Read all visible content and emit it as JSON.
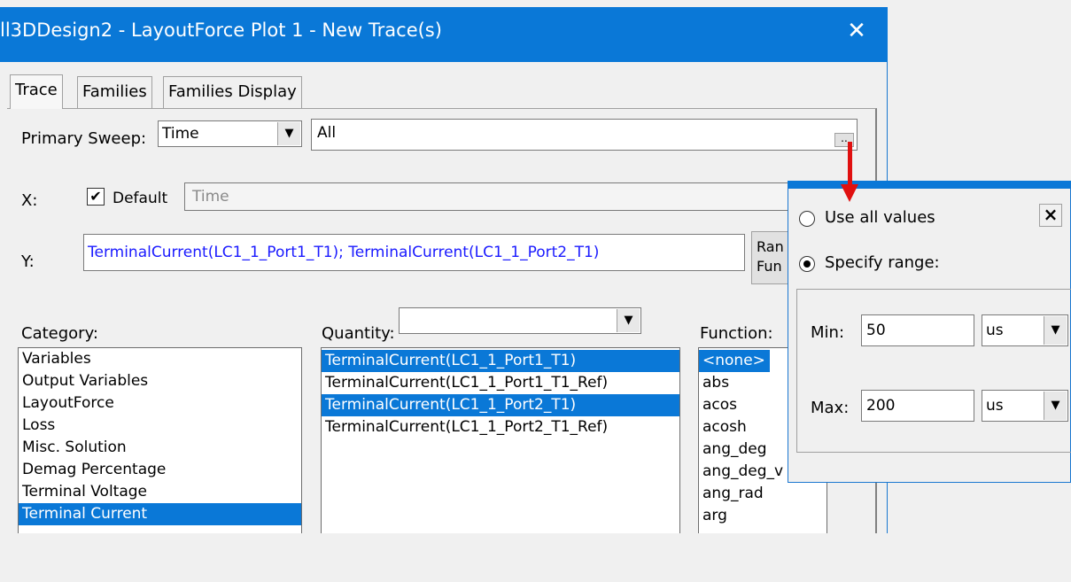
{
  "window": {
    "title": "ll3DDesign2 - LayoutForce Plot 1 - New Trace(s)",
    "close_glyph": "✕"
  },
  "tabs": [
    "Trace",
    "Families",
    "Families Display"
  ],
  "primary_sweep": {
    "label": "Primary Sweep:",
    "value": "Time",
    "range_value": "All",
    "ellipsis_label": ".."
  },
  "x": {
    "label": "X:",
    "default_label": "Default",
    "default_checked": true,
    "value": "Time"
  },
  "y": {
    "label": "Y:",
    "value": "TerminalCurrent(LC1_1_Port1_T1); TerminalCurrent(LC1_1_Port2_T1)",
    "button_line1": "Ran",
    "button_line2": "Fun"
  },
  "category": {
    "label": "Category:",
    "items": [
      "Variables",
      "Output Variables",
      "LayoutForce",
      "Loss",
      "Misc. Solution",
      "Demag Percentage",
      "Terminal Voltage",
      "Terminal Current"
    ],
    "selected": [
      7
    ]
  },
  "quantity": {
    "label": "Quantity:",
    "filter_value": "",
    "items": [
      "TerminalCurrent(LC1_1_Port1_T1)",
      "TerminalCurrent(LC1_1_Port1_T1_Ref)",
      "TerminalCurrent(LC1_1_Port2_T1)",
      "TerminalCurrent(LC1_1_Port2_T1_Ref)"
    ],
    "selected": [
      0,
      2
    ]
  },
  "function": {
    "label": "Function:",
    "items": [
      "<none>",
      "abs",
      "acos",
      "acosh",
      "ang_deg",
      "ang_deg_v",
      "ang_rad",
      "arg"
    ],
    "selected": [
      0
    ]
  },
  "range_popup": {
    "close_glyph": "×",
    "use_all_label": "Use all values",
    "use_all_selected": false,
    "specify_label": "Specify range:",
    "specify_selected": true,
    "min_label": "Min:",
    "min_value": "50",
    "min_unit": "us",
    "max_label": "Max:",
    "max_value": "200",
    "max_unit": "us"
  },
  "colors": {
    "title_bar": "#0a78d7",
    "selection": "#0a78d7",
    "y_text": "#1a1aff",
    "annotation_arrow": "#e01010"
  },
  "icons": {
    "dropdown": "chevron-down-icon",
    "checkbox_check": "check-icon",
    "annotation": "red-arrow-icon"
  }
}
